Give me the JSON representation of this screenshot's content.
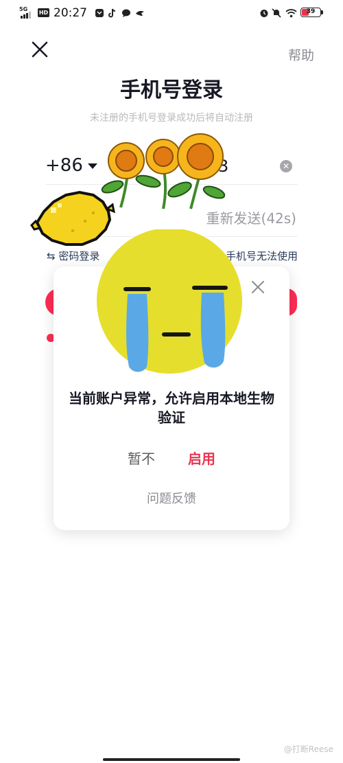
{
  "status_bar": {
    "network": "5G",
    "hd": "HD",
    "time": "20:27",
    "battery_level": "39",
    "icons": [
      "notification-box-icon",
      "tiktok-icon",
      "chat-bubble-icon",
      "bird-icon",
      "alarm-icon",
      "mute-icon",
      "wifi-icon",
      "battery-icon"
    ]
  },
  "header": {
    "help_label": "帮助",
    "title": "手机号登录",
    "subtitle": "未注册的手机号登录成功后将自动注册"
  },
  "form": {
    "country_code": "+86",
    "phone_visible_fragment": "3",
    "resend_label": "重新发送(42s)",
    "password_login_label": "⇆ 密码登录",
    "phone_unusable_label": "手机号无法使用"
  },
  "dialog": {
    "message": "当前账户异常，允许启用本地生物验证",
    "later_label": "暂不",
    "enable_label": "启用",
    "feedback_label": "问题反馈"
  },
  "footer": {
    "watermark": "@打断Reese"
  },
  "colors": {
    "accent": "#fe2c55",
    "enable_text": "#e83552",
    "link": "#2b3b58",
    "muted": "#8a8b91",
    "background": "#ffffff"
  }
}
